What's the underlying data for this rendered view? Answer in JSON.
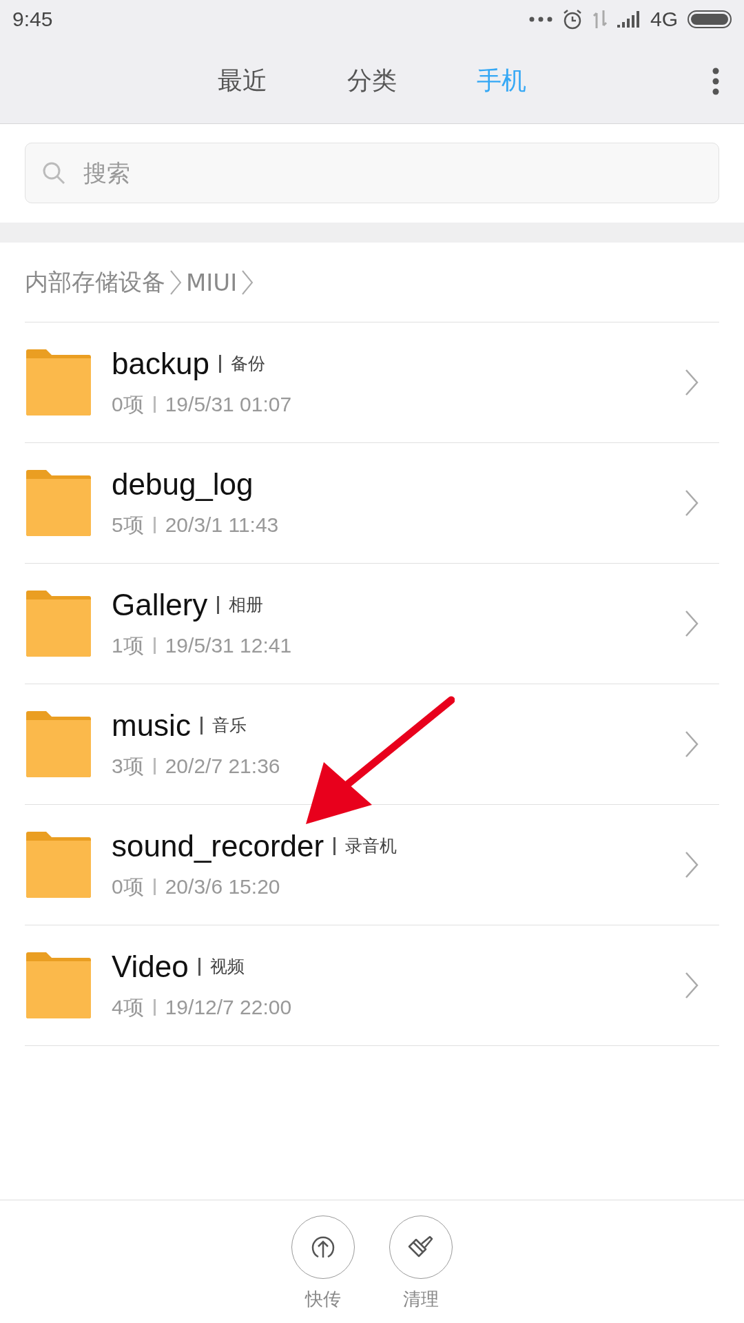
{
  "status_bar": {
    "time": "9:45",
    "network": "4G"
  },
  "tabs": [
    {
      "label": "最近",
      "selected": false
    },
    {
      "label": "分类",
      "selected": false
    },
    {
      "label": "手机",
      "selected": true
    }
  ],
  "search": {
    "placeholder": "搜索"
  },
  "breadcrumb": [
    "内部存储设备",
    "MIUI"
  ],
  "folders": [
    {
      "name": "backup",
      "alias": "备份",
      "count": "0项",
      "date": "19/5/31 01:07"
    },
    {
      "name": "debug_log",
      "count": "5项",
      "date": "20/3/1 11:43"
    },
    {
      "name": "Gallery",
      "alias": "相册",
      "count": "1项",
      "date": "19/5/31 12:41"
    },
    {
      "name": "music",
      "alias": "音乐",
      "count": "3项",
      "date": "20/2/7 21:36"
    },
    {
      "name": "sound_recorder",
      "alias": "录音机",
      "count": "0项",
      "date": "20/3/6 15:20"
    },
    {
      "name": "Video",
      "alias": "视频",
      "count": "4项",
      "date": "19/12/7 22:00"
    }
  ],
  "actions": [
    {
      "kind": "transfer",
      "label": "快传"
    },
    {
      "kind": "clean",
      "label": "清理"
    }
  ]
}
